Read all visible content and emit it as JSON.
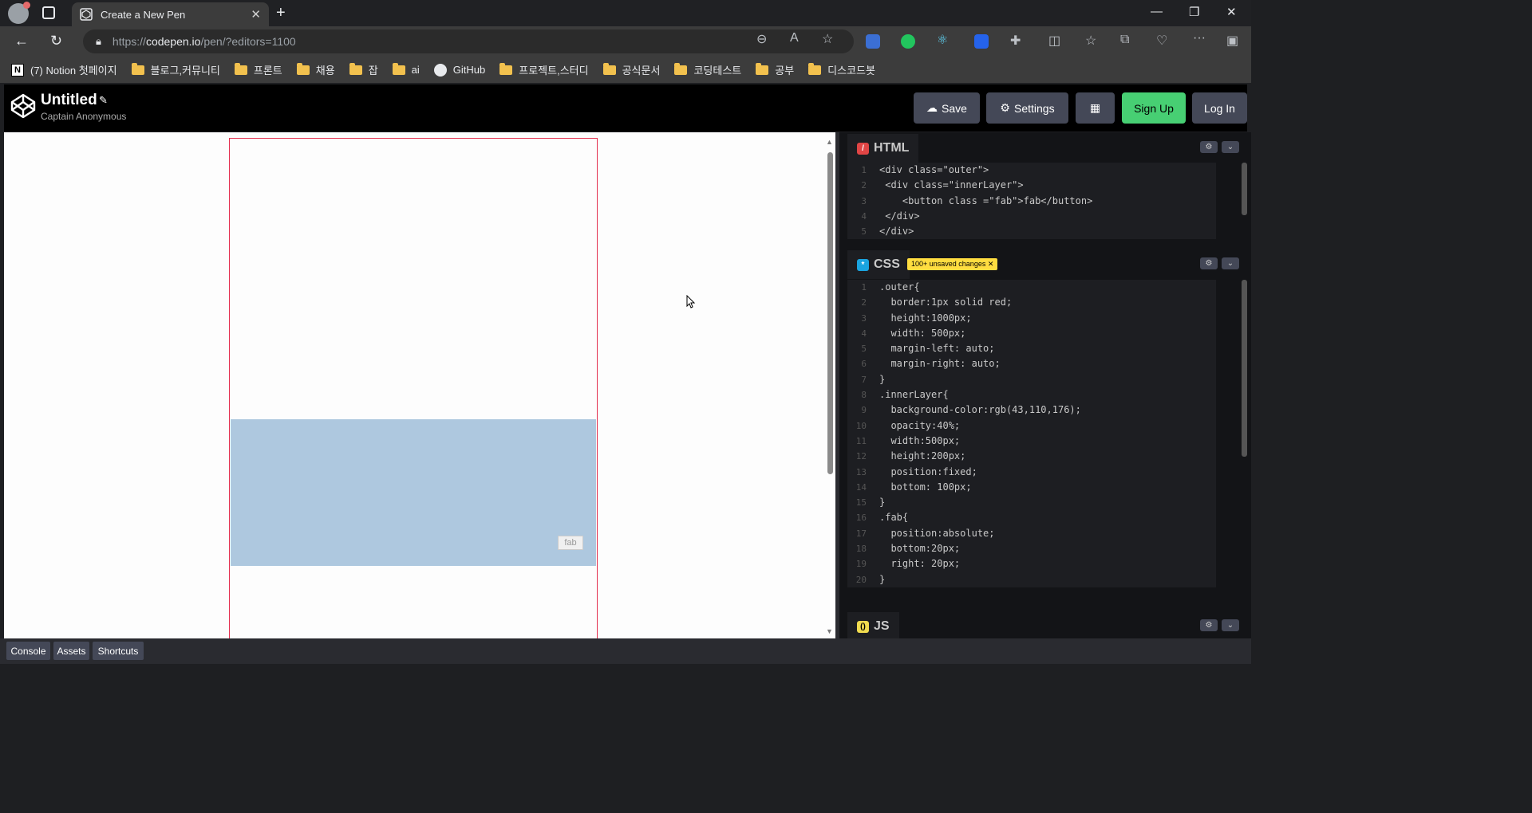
{
  "browser": {
    "tab_title": "Create a New Pen",
    "url_prefix": "https://",
    "url_host": "codepen.io",
    "url_path": "/pen/?editors=1100"
  },
  "bookmarks": [
    {
      "label": "(7) Notion 첫페이지",
      "icon": "notion-icon"
    },
    {
      "label": "블로그,커뮤니티",
      "icon": "folder-icon"
    },
    {
      "label": "프론트",
      "icon": "folder-icon"
    },
    {
      "label": "채용",
      "icon": "folder-icon"
    },
    {
      "label": "잡",
      "icon": "folder-icon"
    },
    {
      "label": "ai",
      "icon": "folder-icon"
    },
    {
      "label": "GitHub",
      "icon": "github-icon"
    },
    {
      "label": "프로젝트,스터디",
      "icon": "folder-icon"
    },
    {
      "label": "공식문서",
      "icon": "folder-icon"
    },
    {
      "label": "코딩테스트",
      "icon": "folder-icon"
    },
    {
      "label": "공부",
      "icon": "folder-icon"
    },
    {
      "label": "디스코드봇",
      "icon": "folder-icon"
    }
  ],
  "codepen": {
    "title": "Untitled",
    "author": "Captain Anonymous",
    "save_label": "Save",
    "settings_label": "Settings",
    "signup_label": "Sign Up",
    "login_label": "Log In"
  },
  "preview": {
    "fab_label": "fab"
  },
  "html_pane": {
    "label": "HTML",
    "lines": [
      "<div class=\"outer\">",
      " <div class=\"innerLayer\">",
      "    <button class =\"fab\">fab</button>",
      " </div>",
      "</div>"
    ]
  },
  "css_pane": {
    "label": "CSS",
    "badge": "100+ unsaved changes ✕",
    "lines": [
      ".outer{",
      "  border:1px solid red;",
      "  height:1000px;",
      "  width: 500px;",
      "  margin-left: auto;",
      "  margin-right: auto;",
      "}",
      ".innerLayer{",
      "  background-color:rgb(43,110,176);",
      "  opacity:40%;",
      "  width:500px;",
      "  height:200px;",
      "  position:fixed;",
      "  bottom: 100px;",
      "}",
      ".fab{",
      "  position:absolute;",
      "  bottom:20px;",
      "  right: 20px;",
      "}"
    ]
  },
  "js_pane": {
    "label": "JS"
  },
  "footer": {
    "console_label": "Console",
    "assets_label": "Assets",
    "shortcuts_label": "Shortcuts"
  },
  "colors": {
    "accent_green": "#47cf73",
    "outer_border": "#e43050",
    "inner_layer": "#aec8df"
  }
}
